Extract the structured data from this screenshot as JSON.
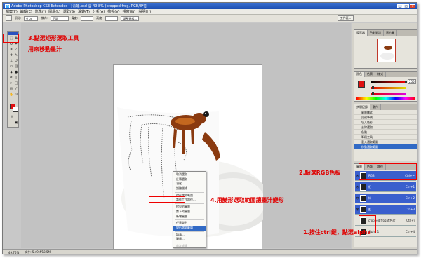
{
  "titlebar": {
    "title": "Adobe Photoshop CS3 Extended - [青蛙.psd @ 49.8% (cropped frog, RGB/8*)]"
  },
  "menubar": {
    "items": [
      "檔案(F)",
      "編輯(E)",
      "影像(I)",
      "圖層(L)",
      "選取(S)",
      "濾鏡(T)",
      "分析(A)",
      "檢視(V)",
      "視窗(W)",
      "說明(H)"
    ]
  },
  "optbar": {
    "feather_label": "羽化:",
    "feather_value": "0 px",
    "style_label": "樣式:",
    "style_value": "正常",
    "width_label": "寬度:",
    "height_label": "高度:",
    "refine_label": "調整邊緣...",
    "workspace_label": "工作區 ▾"
  },
  "context_menu": {
    "items": [
      {
        "label": "取消選取",
        "state": "normal"
      },
      {
        "label": "反轉選取",
        "state": "normal"
      },
      {
        "label": "羽化...",
        "state": "normal"
      },
      {
        "label": "調整邊緣...",
        "state": "normal"
      },
      {
        "sep": true
      },
      {
        "label": "儲存選取範圍...",
        "state": "normal"
      },
      {
        "label": "製作工作路徑...",
        "state": "normal"
      },
      {
        "sep": true
      },
      {
        "label": "拷貝的圖層",
        "state": "normal"
      },
      {
        "label": "剪下的圖層",
        "state": "normal"
      },
      {
        "label": "新增圖層...",
        "state": "normal"
      },
      {
        "sep": true
      },
      {
        "label": "任意變形",
        "state": "normal"
      },
      {
        "label": "變形選取範圍",
        "state": "highlight"
      },
      {
        "sep": true
      },
      {
        "label": "填滿...",
        "state": "normal"
      },
      {
        "label": "筆畫...",
        "state": "normal"
      },
      {
        "sep": true
      },
      {
        "label": "前次濾鏡",
        "state": "disabled"
      },
      {
        "label": "淡化...",
        "state": "disabled"
      }
    ]
  },
  "statusbar": {
    "zoom": "49.76%",
    "doc": "文件: 5.49M/13.5M"
  },
  "panels": {
    "navigator_tabs": [
      "導覽器",
      "色彩資訊",
      "直方圖"
    ],
    "color_tabs": [
      "顏色",
      "色票",
      "樣式"
    ],
    "color_value": "255",
    "history_tabs": [
      "步驟記錄",
      "動作"
    ],
    "history_items": [
      "圖層樣式",
      "貝殼筆刷",
      "填入色彩",
      "去除選取",
      "色階",
      "筆刷工具",
      "載入選取範圍",
      "移動選取範圍"
    ],
    "channel_tabs": [
      "圖層",
      "色版",
      "路徑"
    ],
    "channels": [
      {
        "name": "RGB",
        "shortcut": "Ctrl+~",
        "color": "#3a5fcd"
      },
      {
        "name": "紅",
        "shortcut": "Ctrl+1",
        "color": "#3a5fcd"
      },
      {
        "name": "綠",
        "shortcut": "Ctrl+2",
        "color": "#3a5fcd"
      },
      {
        "name": "藍",
        "shortcut": "Ctrl+3",
        "color": "#3a5fcd"
      },
      {
        "name": "cropped frog 遮色片",
        "shortcut": "Ctrl+\\",
        "color": "#e6e4dc"
      },
      {
        "name": "Alpha 1",
        "shortcut": "Ctrl+4",
        "color": "#e6e4dc"
      }
    ]
  },
  "annotations": {
    "step3_line1": "3.點選矩形選取工具",
    "step3_line2": "用來移動墨汁",
    "step2": "2.點選RGB色板",
    "step4": "4.用變形選取範圍讓墨汁變形",
    "step1": "1.按住ctrl鍵，點選alpha"
  },
  "colors": {
    "annotation": "#e00000",
    "selection_blue": "#316ac5",
    "foreground": "#e01010"
  }
}
